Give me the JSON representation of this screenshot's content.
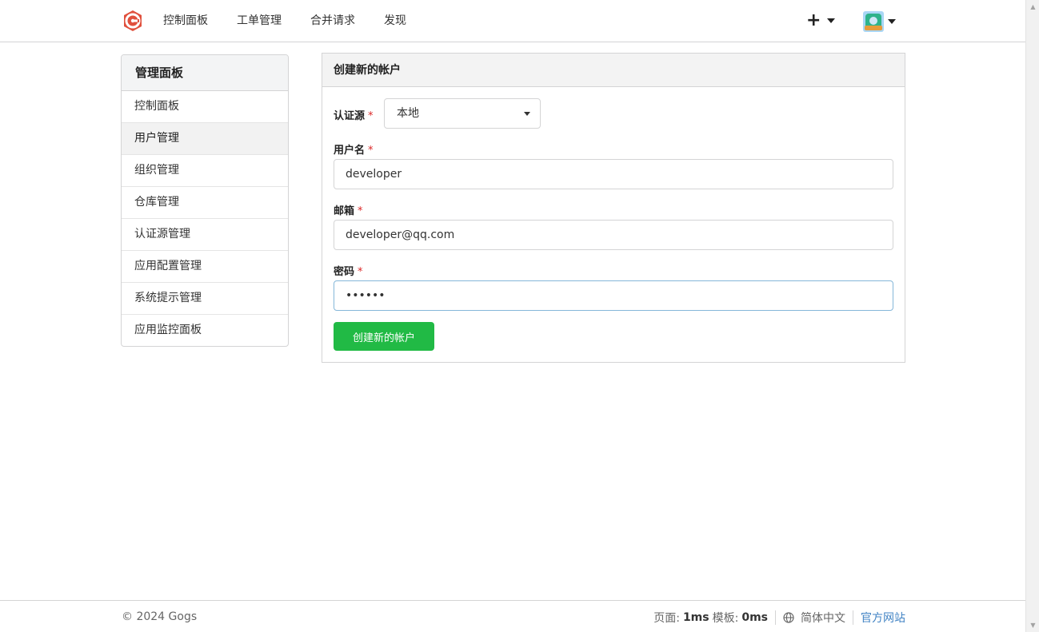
{
  "nav": {
    "items": [
      "控制面板",
      "工单管理",
      "合并请求",
      "发现"
    ]
  },
  "sidebar": {
    "title": "管理面板",
    "items": [
      {
        "label": "控制面板"
      },
      {
        "label": "用户管理"
      },
      {
        "label": "组织管理"
      },
      {
        "label": "仓库管理"
      },
      {
        "label": "认证源管理"
      },
      {
        "label": "应用配置管理"
      },
      {
        "label": "系统提示管理"
      },
      {
        "label": "应用监控面板"
      }
    ],
    "active_index": 1
  },
  "form": {
    "title": "创建新的帐户",
    "auth_source_label": "认证源",
    "auth_source_value": "本地",
    "username_label": "用户名",
    "username_value": "developer",
    "email_label": "邮箱",
    "email_value": "developer@qq.com",
    "password_label": "密码",
    "password_value": "••••••",
    "required_mark": "*",
    "submit_label": "创建新的帐户"
  },
  "footer": {
    "copyright": "© 2024 Gogs",
    "page_label": "页面:",
    "page_time": "1ms",
    "template_label": "模板:",
    "template_time": "0ms",
    "language": "简体中文",
    "official_site": "官方网站"
  },
  "colors": {
    "accent_green": "#21ba45",
    "link_blue": "#4183c4",
    "required_red": "#db2828",
    "logo_red": "#e0503d"
  },
  "icons": {
    "logo": "gogs-logo-icon",
    "plus": "plus-icon",
    "caret": "caret-down-icon",
    "globe": "globe-icon"
  }
}
